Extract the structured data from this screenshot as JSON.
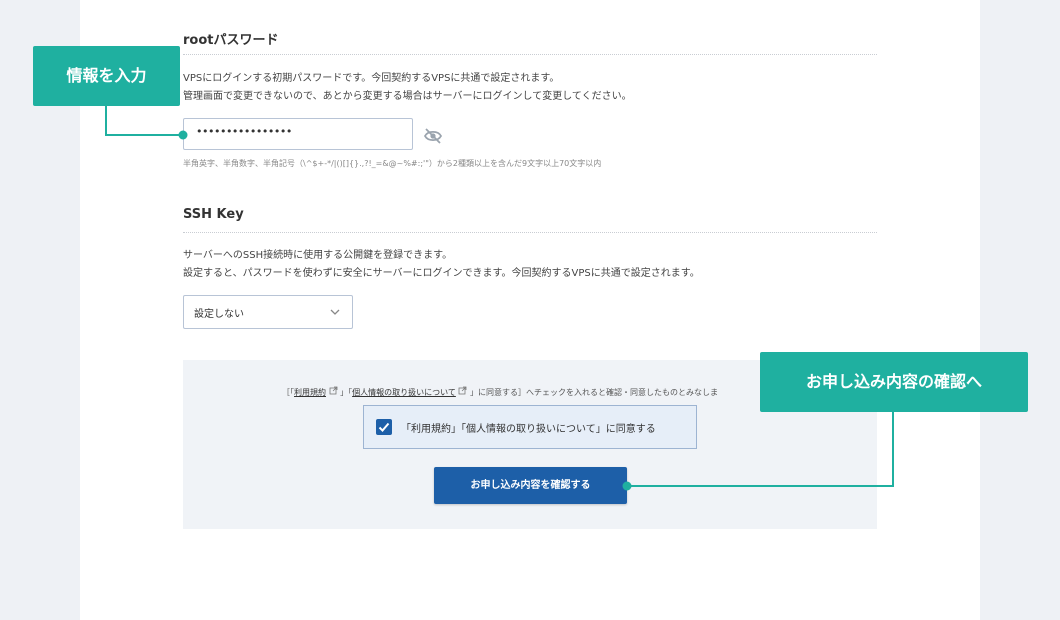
{
  "root_password": {
    "title": "rootパスワード",
    "desc_line1": "VPSにログインする初期パスワードです。今回契約するVPSに共通で設定されます。",
    "desc_line2": "管理画面で変更できないので、あとから変更する場合はサーバーにログインして変更してください。",
    "value": "••••••••••••••••",
    "hint": "半角英字、半角数字、半角記号（\\^$+-*/|()[]{}.,?!_=&@~%#:;'\"）から2種類以上を含んだ9文字以上70文字以内"
  },
  "ssh_key": {
    "title": "SSH Key",
    "desc_line1": "サーバーへのSSH接続時に使用する公開鍵を登録できます。",
    "desc_line2": "設定すると、パスワードを使わずに安全にサーバーにログインできます。今回契約するVPSに共通で設定されます。",
    "selected": "設定しない"
  },
  "agreement": {
    "note_prefix": "［「",
    "link_terms": "利用規約",
    "note_mid": "」「",
    "link_privacy": "個人情報の取り扱いについて",
    "note_suffix": "」に同意する］へチェックを入れると確認・同意したものとみなしま",
    "checkbox_label": "「利用規約」「個人情報の取り扱いについて」に同意する",
    "checked": true,
    "submit_label": "お申し込み内容を確認する"
  },
  "callouts": {
    "input_info": "情報を入力",
    "confirm": "お申し込み内容の確認へ"
  },
  "colors": {
    "accent": "#1fb0a0",
    "primary": "#1d5fa8",
    "background": "#eef1f5"
  },
  "icons": [
    "eye-off-icon",
    "chevron-down-icon",
    "external-link-icon",
    "check-icon"
  ]
}
